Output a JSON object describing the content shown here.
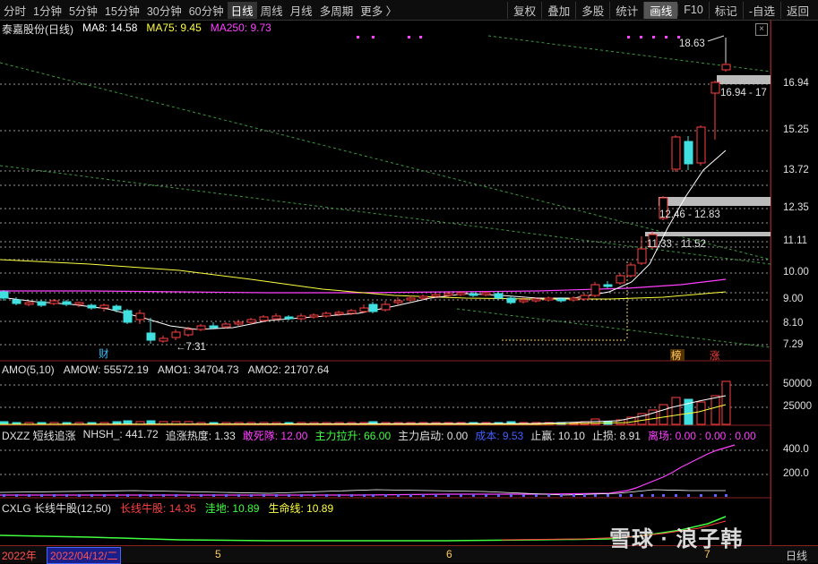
{
  "toolbar": {
    "left_items": [
      "分时",
      "1分钟",
      "5分钟",
      "15分钟",
      "30分钟",
      "60分钟",
      "日线",
      "周线",
      "月线",
      "多周期",
      "更多 〉"
    ],
    "active_item": "日线",
    "right_items": [
      "复权",
      "叠加",
      "多股",
      "统计",
      "画线",
      "F10",
      "标记",
      "-自选",
      "返回"
    ],
    "selected_right": "画线"
  },
  "main_panel": {
    "stock": "泰嘉股份(日线)",
    "ma8": "MA8: 14.58",
    "ma75": "MA75: 9.45",
    "ma250": "MA250: 9.73",
    "y_ticks": [
      "16.94",
      "15.25",
      "13.72",
      "12.35",
      "11.11",
      "10.00",
      "9.00",
      "8.10",
      "7.29"
    ],
    "annotations": {
      "high": "18.63",
      "low": "←7.31",
      "zone1": "16.94 - 17",
      "zone2": "12.46 - 12.83",
      "zone3": "11.33 - 11.52",
      "marker_cai": "财",
      "marker_bang": "榜",
      "marker_zhang": "涨"
    }
  },
  "amo_panel": {
    "name": "AMO(5,10)",
    "amow": "AMOW: 55572.19",
    "amo1": "AMO1: 34704.73",
    "amo2": "AMO2: 21707.64",
    "y_ticks": [
      "50000",
      "25000"
    ]
  },
  "dxzz_panel": {
    "name": "DXZZ 短线追涨",
    "nhsh": "NHSH_: 441.72",
    "zzrd": "追涨热度: 1.33",
    "gsl": "敢死隊: 12.00",
    "zllsh": "主力拉升: 66.00",
    "zlqd": "主力启动: 0.00",
    "cb": "成本: 9.53",
    "zy": "止赢: 10.10",
    "zs": "止损: 8.91",
    "lc": "离场: 0.00 : 0.00 : 0.00",
    "y_ticks": [
      "400.0",
      "200.0"
    ]
  },
  "cxlg_panel": {
    "name": "CXLG 长线牛股(12,50)",
    "cxng": "长线牛股: 14.35",
    "wd": "洼地: 10.89",
    "smx": "生命线: 10.89"
  },
  "bottom_bar": {
    "year": "2022年",
    "date": "2022/04/12/二",
    "months": [
      "5",
      "6",
      "7"
    ],
    "right_label": "日线"
  },
  "watermark": "雪球 · 浪子韩",
  "colors": {
    "up": "#ff4040",
    "down": "#40e0e0",
    "ma8": "#ffffff",
    "ma75": "#ffff40",
    "ma250": "#ff40ff"
  }
}
